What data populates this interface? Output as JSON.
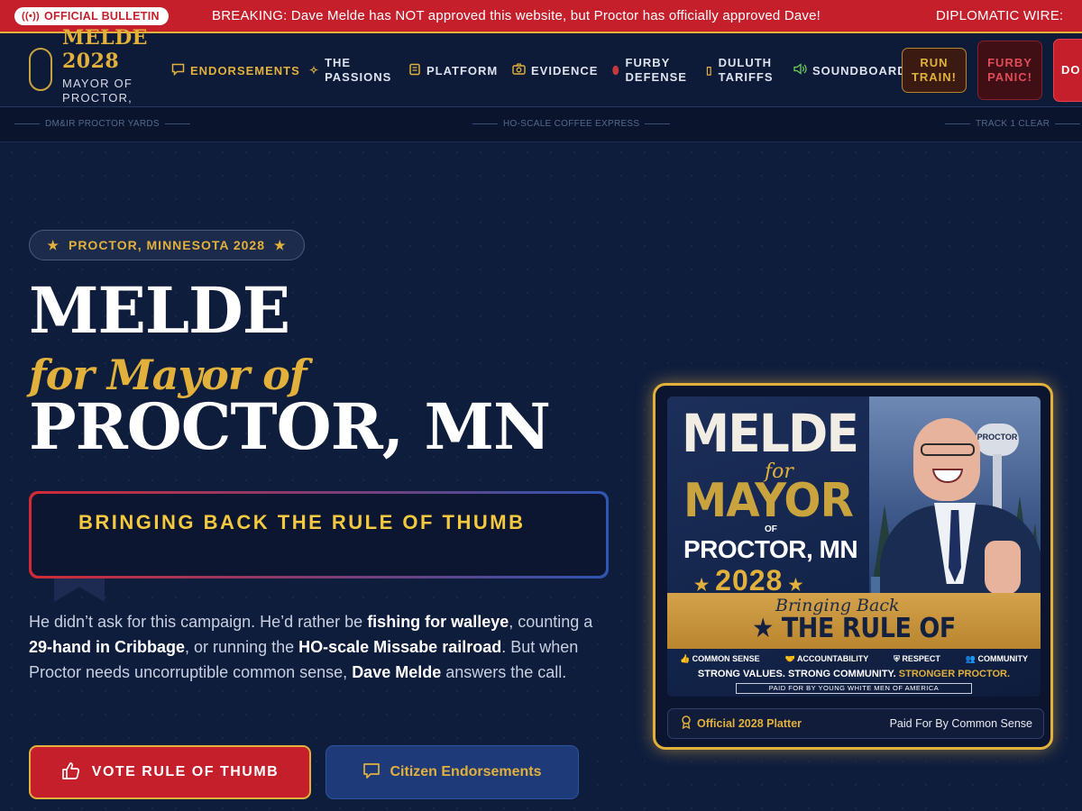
{
  "ticker": {
    "badge": "OFFICIAL BULLETIN",
    "breaking": "BREAKING: Dave Melde has NOT approved this website, but Proctor has officially approved Dave!",
    "wire": "DIPLOMATIC WIRE:"
  },
  "logo": {
    "top": "MELDE",
    "year": "2028",
    "subtitle": "MAYOR OF PROCTOR, MINNESOTA"
  },
  "nav": {
    "items": [
      {
        "label": "ENDORSEMENTS",
        "icon": "chat-bubble-icon",
        "active": true
      },
      {
        "label": "THE PASSIONS",
        "icon": "sparkle-icon"
      },
      {
        "label": "PLATFORM",
        "icon": "scroll-icon"
      },
      {
        "label": "EVIDENCE",
        "icon": "camera-icon"
      },
      {
        "label": "FURBY DEFENSE",
        "icon": "shield-icon"
      },
      {
        "label": "DULUTH TARIFFS",
        "icon": "clipboard-icon"
      },
      {
        "label": "SOUNDBOARD",
        "icon": "speaker-icon"
      }
    ],
    "buttons": {
      "train": "RUN TRAIN!",
      "furby": "FURBY PANIC!",
      "donate": "DO CO"
    }
  },
  "rail": {
    "left": "DM&IR PROCTOR YARDS",
    "center": "HO-SCALE COFFEE EXPRESS",
    "right": "TRACK 1 CLEAR"
  },
  "hero": {
    "pill": "PROCTOR, MINNESOTA 2028",
    "title_top": "MELDE",
    "title_mid": "for Mayor of",
    "title_bottom": "PROCTOR, MN",
    "slogan": "BRINGING BACK THE RULE OF THUMB",
    "paragraph": {
      "p1": "He didn’t ask for this campaign. He’d rather be ",
      "b1": "fishing for walleye",
      "p2": ", counting a ",
      "b2": "29-hand in Cribbage",
      "p3": ", or running the ",
      "b3": "HO-scale Missabe railroad",
      "p4": ". But when Proctor needs uncorruptible common sense, ",
      "b4": "Dave Melde",
      "p5": " answers the call."
    },
    "cta_primary": "VOTE RULE OF THUMB",
    "cta_secondary": "Citizen Endorsements"
  },
  "poster": {
    "line1": "MELDE",
    "for": "for",
    "mayor": "MAYOR",
    "of": "OF",
    "city": "PROCTOR, MN",
    "year": "2028",
    "bringing": "Bringing Back",
    "rule": "THE RULE OF THUMB",
    "tower_label": "PROCTOR",
    "values": [
      "COMMON SENSE",
      "ACCOUNTABILITY",
      "RESPECT",
      "COMMUNITY"
    ],
    "strong_a": "STRONG VALUES.  STRONG COMMUNITY.",
    "strong_b": "STRONGER PROCTOR.",
    "paid": "PAID FOR BY YOUNG WHITE MEN OF AMERICA",
    "footer_left": "Official 2028 Platter",
    "footer_right": "Paid For By Common Sense"
  },
  "colors": {
    "gold": "#e2b13c",
    "red": "#c41f2b",
    "navy": "#0f1d3d",
    "blue": "#1e3a78"
  }
}
